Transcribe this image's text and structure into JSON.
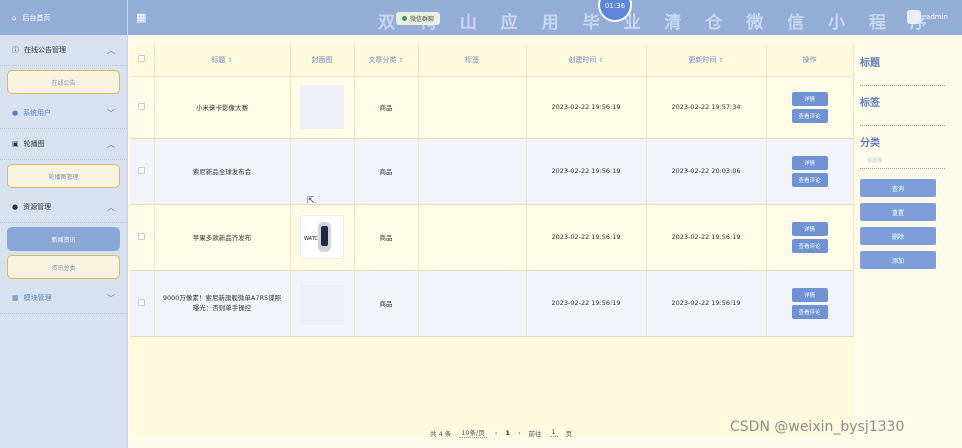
{
  "colors": {
    "header": "#93add6",
    "sidebar": "#d8e1ef",
    "accent": "#6f92d2",
    "table_bg": "#fff9dd"
  },
  "sidebar": {
    "home": {
      "icon": "home-icon",
      "label": "后台首页"
    },
    "groups": [
      {
        "label": "在线公告管理",
        "icon": "info-icon",
        "chevron": "︿",
        "subs": [
          "在线公告"
        ]
      },
      {
        "label": "系统用户",
        "icon": "user-icon",
        "chevron": "﹀",
        "subs": []
      },
      {
        "label": "轮播图",
        "icon": "image-icon",
        "chevron": "︿",
        "subs": [
          "轮播图管理"
        ]
      },
      {
        "label": "资源管理",
        "icon": "location-icon",
        "chevron": "︿",
        "subs": [
          "新闻资讯",
          "资讯分类"
        ]
      },
      {
        "label": "模块管理",
        "icon": "grid-icon",
        "chevron": "﹀",
        "subs": []
      }
    ]
  },
  "header": {
    "title": "双 鸭 山 应 用 毕 业 清 仓 微 信 小 程 序",
    "badge": "微信群聊",
    "clock": "01:36",
    "user": "admin"
  },
  "table": {
    "columns": [
      "标题",
      "封面图",
      "文章分类",
      "标签",
      "创建时间",
      "更新时间",
      "操作"
    ],
    "sort_glyph": "⇕",
    "rows": [
      {
        "title": "小米徕卡影像大赛",
        "category": "商品",
        "tag": "",
        "created": "2023-02-22 19:56:19",
        "updated": "2023-02-22 19:57:34",
        "cover": "blank"
      },
      {
        "title": "索尼新品全球发布会",
        "category": "商品",
        "tag": "",
        "created": "2023-02-22 19:56:19",
        "updated": "2023-02-22 20:03:06",
        "cover": "none"
      },
      {
        "title": "苹果多款新品齐发布",
        "category": "商品",
        "tag": "",
        "created": "2023-02-22 19:56:19",
        "updated": "2023-02-22 19:56:19",
        "cover": "watch",
        "cover_label": "WATCH"
      },
      {
        "title": "9000万像素！索尼新旗舰微单A7R5谍照曝光：否则单手操控",
        "category": "商品",
        "tag": "",
        "created": "2023-02-22 19:56:19",
        "updated": "2023-02-22 19:56:19",
        "cover": "blank"
      }
    ],
    "actions": [
      "详情",
      "查看评论"
    ]
  },
  "pager": {
    "total": "共 4 条",
    "page_size": "10条/页",
    "prev": "‹",
    "current": "1",
    "next": "›",
    "goto_prefix": "前往",
    "goto_value": "1",
    "goto_suffix": "页"
  },
  "filters": {
    "title_label": "标题",
    "tag_label": "标签",
    "category_label": "分类",
    "category_placeholder": "请选择",
    "buttons": [
      "查询",
      "重置",
      "删除",
      "添加"
    ]
  },
  "watermark": "CSDN @weixin_bysj1330"
}
